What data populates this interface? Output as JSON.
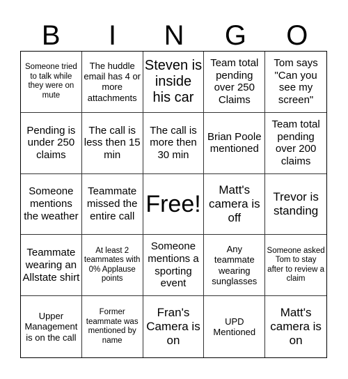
{
  "header": {
    "letters": [
      "B",
      "I",
      "N",
      "G",
      "O"
    ]
  },
  "cells": [
    {
      "text": "Someone tried to talk while they were on mute",
      "size": "xs"
    },
    {
      "text": "The huddle email has 4 or more attachments",
      "size": "sm"
    },
    {
      "text": "Steven is inside his car",
      "size": "xl"
    },
    {
      "text": "Team total pending over 250 Claims",
      "size": "md"
    },
    {
      "text": "Tom says \"Can you see my screen\"",
      "size": "md"
    },
    {
      "text": "Pending is under 250 claims",
      "size": "md"
    },
    {
      "text": "The call is less then 15 min",
      "size": "md"
    },
    {
      "text": "The call is more then 30 min",
      "size": "md"
    },
    {
      "text": "Brian Poole mentioned",
      "size": "md"
    },
    {
      "text": "Team total pending over 200 claims",
      "size": "md"
    },
    {
      "text": "Someone mentions the weather",
      "size": "md"
    },
    {
      "text": "Teammate missed the entire call",
      "size": "md"
    },
    {
      "text": "Free!",
      "size": "free"
    },
    {
      "text": "Matt's camera is off",
      "size": "lg"
    },
    {
      "text": "Trevor is standing",
      "size": "lg"
    },
    {
      "text": "Teammate wearing an Allstate shirt",
      "size": "md"
    },
    {
      "text": "At least 2 teammates with 0% Applause points",
      "size": "xs"
    },
    {
      "text": "Someone mentions a sporting event",
      "size": "md"
    },
    {
      "text": "Any teammate wearing sunglasses",
      "size": "sm"
    },
    {
      "text": "Someone asked Tom to stay after to review a claim",
      "size": "xs"
    },
    {
      "text": "Upper Management is on the call",
      "size": "sm"
    },
    {
      "text": "Former teammate was mentioned by name",
      "size": "xs"
    },
    {
      "text": "Fran's Camera is on",
      "size": "lg"
    },
    {
      "text": "UPD Mentioned",
      "size": "sm"
    },
    {
      "text": "Matt's camera is on",
      "size": "lg"
    }
  ]
}
